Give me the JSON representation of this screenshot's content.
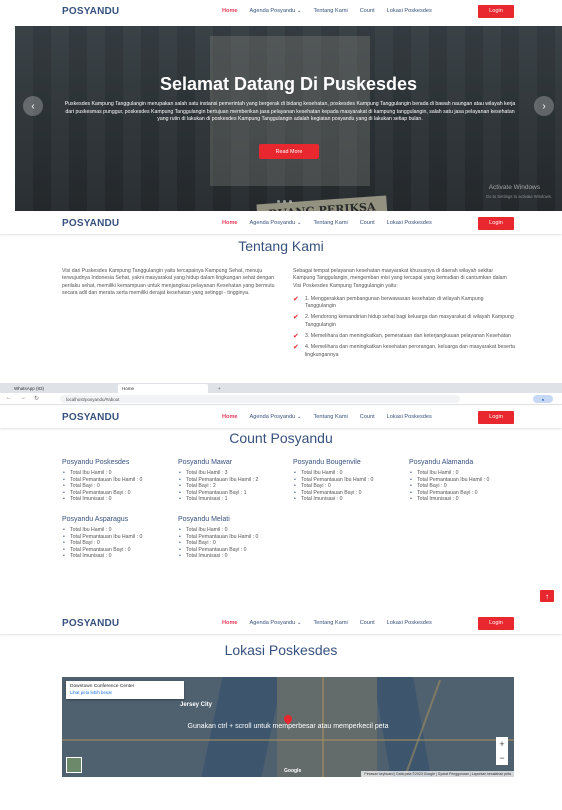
{
  "nav": {
    "brand": "POSYANDU",
    "items": [
      "Home",
      "Agenda Posyandu ⌄",
      "Tentang Kami",
      "Count",
      "Lokasi Poskesdes"
    ],
    "login": "Login"
  },
  "hero": {
    "title": "Selamat Datang Di Puskesdes",
    "description": "Puskesdes Kampung Tanggulangin merupakan salah satu instansi pemerintah yang bergerak di bidang kesehatan, poskesdes Kampung Tanggulangin berada di bawah naungan atau wilayah kerja dari puskesmas punggur, poskesdes Kampung Tanggulangin bertujuan memberikan jasa pelayanan kesehatan kepada masyarakat di kampung tanggulangin, salah satu jasa pelayanan kesehatan yang rutin di lakukan di poskesdes Kampung Tanggulangin adalah kegiatan posyandu yang di lakukan setiap bulan.",
    "read_more": "Read More",
    "sign_text": "RUANG PERIKSA",
    "watermark": "Activate Windows",
    "watermark_sub": "Go to Settings to activate Windows."
  },
  "about": {
    "title": "Tentang Kami",
    "left_text": "Visi dari Puskesdes Kampung Tanggulangin yaitu tercapainya Kampung Sehat, menuju terwujudnya Indonesia Sehat, yakni masyarakat yang hidup dalam lingkungan sehat dengan perilaku sehat, memiliki kemampuan untuk menjangkau pelayanan Kesehatan yang bermutu secara adil dan merata serta memiliki derajat kesehatan yang setinggi - tingginya.",
    "right_intro": "Sebagai tempat pelayanan kesehatan masyarakat khususnya di daerah wilayah sekitar Kampung Tanggulangin, mengemban misi yang tercapai yang kemudian di cantumkan dalam Visi Poskesdes Kampung Tanggulangin yaitu:",
    "missions": [
      "1. Menggerakkan pembangunan berwawasan kesehatan di wilayah Kampung Tanggulangin",
      "2. Mendorong kemandirian hidup sehat bagi keluarga dan masyarakat di wilayah Kampung Tanggulangin",
      "3. Memelihara dan meningkatkan, pemerataan dan keterjangkauan pelayanan Kesehatan",
      "4. Memelihara dan meningkatkan kesehatan perorangan, keluarga dan masyarakat beserta lingkungannya"
    ]
  },
  "browser": {
    "tab1": "WhatsApp (83)",
    "tab2": "Home",
    "url": "localhost/posyandu/#about"
  },
  "count": {
    "title": "Count Posyandu",
    "groups": [
      {
        "name": "Posyandu Poskesdes",
        "items": [
          "Total Ibu Hamil : 0",
          "Total Pemantauan Ibu Hamil : 0",
          "Total Bayi : 0",
          "Total Pemantauan Bayi : 0",
          "Total Imunisasi : 0"
        ]
      },
      {
        "name": "Posyandu Mawar",
        "items": [
          "Total Ibu Hamil : 3",
          "Total Pemantauan Ibu Hamil : 2",
          "Total Bayi : 2",
          "Total Pemantauan Bayi : 1",
          "Total Imunisasi : 1"
        ]
      },
      {
        "name": "Posyandu Bougenvile",
        "items": [
          "Total Ibu Hamil : 0",
          "Total Pemantauan Ibu Hamil : 0",
          "Total Bayi : 0",
          "Total Pemantauan Bayi : 0",
          "Total Imunisasi : 0"
        ]
      },
      {
        "name": "Posyandu Alamanda",
        "items": [
          "Total Ibu Hamil : 0",
          "Total Pemantauan Ibu Hamil : 0",
          "Total Bayi : 0",
          "Total Pemantauan Bayi : 0",
          "Total Imunisasi : 0"
        ]
      },
      {
        "name": "Posyandu Asparagus",
        "items": [
          "Total Ibu Hamil : 0",
          "Total Pemantauan Ibu Hamil : 0",
          "Total Bayi : 0",
          "Total Pemantauan Bayi : 0",
          "Total Imunisasi : 0"
        ]
      },
      {
        "name": "Posyandu Melati",
        "items": [
          "Total Ibu Hamil : 0",
          "Total Pemantauan Ibu Hamil : 0",
          "Total Bayi : 0",
          "Total Pemantauan Bayi : 0",
          "Total Imunisasi : 0"
        ]
      }
    ]
  },
  "location": {
    "title": "Lokasi Poskesdes",
    "card_title": "Downtown Conference Center",
    "card_link": "Lihat peta lebih besar",
    "hint": "Gunakan ctrl + scroll untuk memperbesar atau memperkecil peta",
    "city_label": "Jersey City",
    "footer": "Pintasan keyboard | Data peta ©2023 Google | Syarat Penggunaan | Laporkan kesalahan peta",
    "google": "Google"
  },
  "colors": {
    "accent": "#e8272f",
    "navy": "#37517e"
  }
}
